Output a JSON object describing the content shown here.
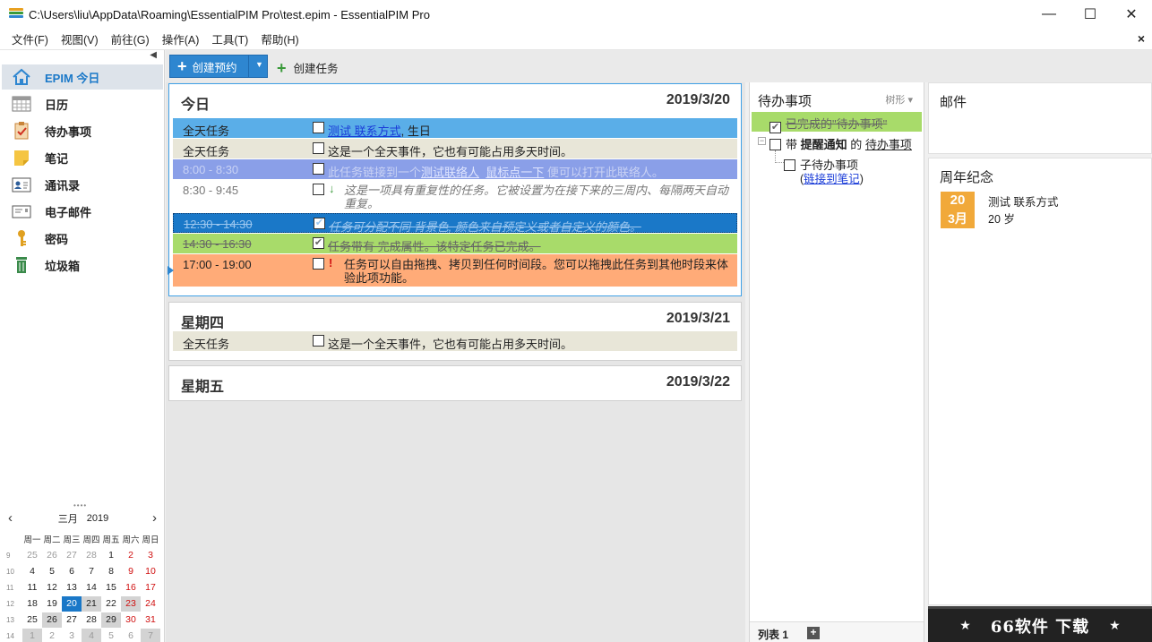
{
  "window": {
    "title": "C:\\Users\\liu\\AppData\\Roaming\\EssentialPIM Pro\\test.epim - EssentialPIM Pro",
    "minimize": "—",
    "maximize": "☐",
    "close": "✕"
  },
  "menu": [
    "文件(F)",
    "视图(V)",
    "前往(G)",
    "操作(A)",
    "工具(T)",
    "帮助(H)"
  ],
  "menu_close": "×",
  "sidebar": {
    "collapse": "◀",
    "items": [
      {
        "label": "EPIM 今日",
        "icon": "home-icon",
        "active": true
      },
      {
        "label": "日历",
        "icon": "calendar-icon"
      },
      {
        "label": "待办事项",
        "icon": "clipboard-check-icon"
      },
      {
        "label": "笔记",
        "icon": "sticky-note-icon"
      },
      {
        "label": "通讯录",
        "icon": "contact-card-icon"
      },
      {
        "label": "电子邮件",
        "icon": "email-icon"
      },
      {
        "label": "密码",
        "icon": "key-icon"
      },
      {
        "label": "垃圾箱",
        "icon": "trash-icon"
      }
    ]
  },
  "minical": {
    "month": "三月",
    "year": "2019",
    "prev": "‹",
    "next": "›",
    "weekdays": [
      "周一",
      "周二",
      "周三",
      "周四",
      "周五",
      "周六",
      "周日"
    ],
    "weeks": [
      {
        "wk": "9",
        "days": [
          "25",
          "26",
          "27",
          "28",
          "1",
          "2",
          "3"
        ]
      },
      {
        "wk": "10",
        "days": [
          "4",
          "5",
          "6",
          "7",
          "8",
          "9",
          "10"
        ]
      },
      {
        "wk": "11",
        "days": [
          "11",
          "12",
          "13",
          "14",
          "15",
          "16",
          "17"
        ]
      },
      {
        "wk": "12",
        "days": [
          "18",
          "19",
          "20",
          "21",
          "22",
          "23",
          "24"
        ]
      },
      {
        "wk": "13",
        "days": [
          "25",
          "26",
          "27",
          "28",
          "29",
          "30",
          "31"
        ]
      },
      {
        "wk": "14",
        "days": [
          "1",
          "2",
          "3",
          "4",
          "5",
          "6",
          "7"
        ]
      }
    ]
  },
  "toolbar": {
    "new_appointment": "创建预约",
    "new_task": "创建任务"
  },
  "today": {
    "name": "今日",
    "date": "2019/3/20",
    "events": [
      {
        "time": "全天任务",
        "link1": "测试 联系方式",
        "text": ", 生日",
        "color": "#5aaee8"
      },
      {
        "time": "全天任务",
        "text": "这是一个全天事件，它也有可能占用多天时间。",
        "color": "#e8e6d8"
      },
      {
        "time": "8:00 - 8:30",
        "text": "此任务链接到一个",
        "link1": "测试联络人",
        "link2": "鼠标点一下",
        "text2": "便可以打开此联络人。",
        "color": "#8a9fe8"
      },
      {
        "time": "8:30 - 9:45",
        "mark": "↓",
        "text": "这是一项具有重复性的任务。它被设置为在接下来的三周内、每隔两天自动重复。",
        "color": "#ffffff"
      },
      {
        "time": "12:30 - 14:30",
        "text": "任务可分配不同 背景色, 颜色来自预定义或者自定义的颜色。",
        "color": "#1a78c8"
      },
      {
        "time": "14:30 - 16:30",
        "text": "任务带有 完成属性。该特定任务已完成。",
        "color": "#a8db6a"
      },
      {
        "time": "17:00 - 19:00",
        "mark": "!",
        "text": "任务可以自由拖拽、拷贝到任何时间段。您可以拖拽此任务到其他时段来体验此项功能。",
        "color": "#ffab78"
      }
    ]
  },
  "thursday": {
    "name": "星期四",
    "date": "2019/3/21",
    "events": [
      {
        "time": "全天任务",
        "text": "这是一个全天事件，它也有可能占用多天时间。",
        "color": "#e8e6d8"
      }
    ]
  },
  "friday": {
    "name": "星期五",
    "date": "2019/3/22"
  },
  "todo": {
    "title": "待办事项",
    "mode": "树形 ▾",
    "done_item": "已完成的\"待办事项\"",
    "item_prefix": "带",
    "item_bold": "提醒通知",
    "item_mid": "的",
    "item_link": "待办事项",
    "subitem": "子待办事项",
    "subitem_link": "链接到笔记",
    "list_tab": "列表 1",
    "add_tab": "+"
  },
  "mail": {
    "title": "邮件"
  },
  "anniversary": {
    "title": "周年纪念",
    "day": "20",
    "month": "3月",
    "name": "测试 联系方式",
    "age": "20 岁"
  },
  "banner": {
    "text": "66软件 下载",
    "star": "★"
  }
}
